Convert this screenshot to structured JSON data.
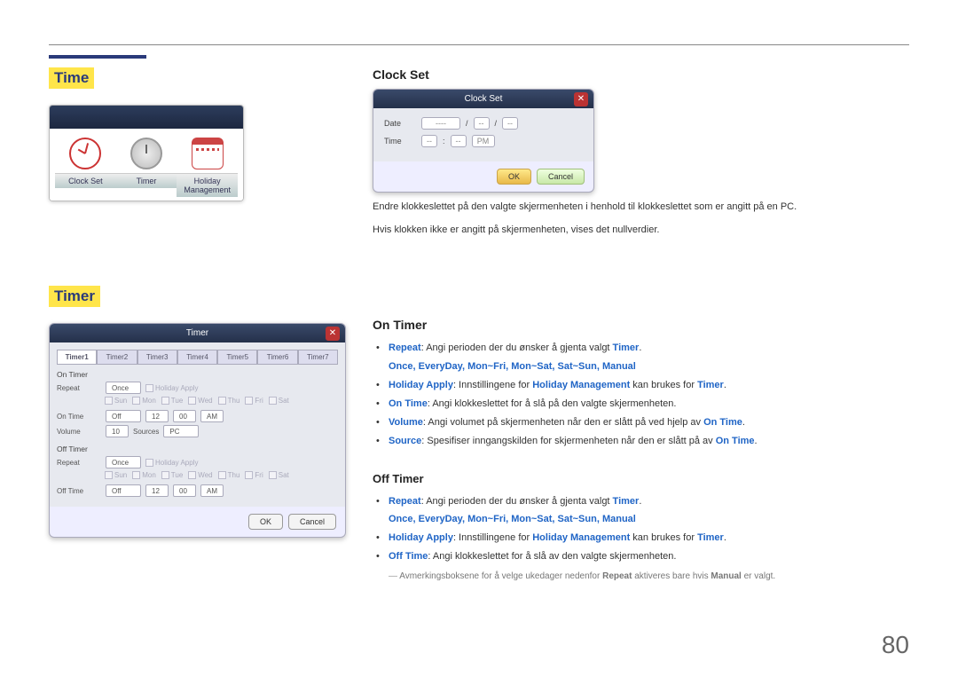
{
  "page_number": "80",
  "left": {
    "time_heading": "Time",
    "timer_heading": "Timer",
    "time_icons": {
      "clock_set": "Clock Set",
      "timer": "Timer",
      "holiday": "Holiday Management"
    },
    "timer_dialog": {
      "title": "Timer",
      "tabs": [
        "Timer1",
        "Timer2",
        "Timer3",
        "Timer4",
        "Timer5",
        "Timer6",
        "Timer7"
      ],
      "on_timer": "On Timer",
      "off_timer": "Off Timer",
      "repeat_label": "Repeat",
      "repeat_value": "Once",
      "holiday_apply": "Holiday Apply",
      "days": [
        "Sun",
        "Mon",
        "Tue",
        "Wed",
        "Thu",
        "Fri",
        "Sat"
      ],
      "on_time_label": "On Time",
      "on_time_on": "Off",
      "hour": "12",
      "min": "00",
      "ampm": "AM",
      "volume_label": "Volume",
      "volume_val": "10",
      "sources_label": "Sources",
      "sources_val": "PC",
      "off_time_label": "Off Time",
      "ok": "OK",
      "cancel": "Cancel"
    }
  },
  "right": {
    "clockset_heading": "Clock Set",
    "clockset_dialog": {
      "title": "Clock Set",
      "date": "Date",
      "time": "Time",
      "dash": "----",
      "dd": "--",
      "pm": "PM",
      "ok": "OK",
      "cancel": "Cancel"
    },
    "clockset_p1": "Endre klokkeslettet på den valgte skjermenheten i henhold til klokkeslettet som er angitt på en PC.",
    "clockset_p2": "Hvis klokken ikke er angitt på skjermenheten, vises det nullverdier.",
    "ontimer_heading": "On Timer",
    "offtimer_heading": "Off Timer",
    "bullets_on": {
      "repeat_pre": "Repeat",
      "repeat_txt": ": Angi perioden der du ønsker å gjenta valgt ",
      "timer_word": "Timer",
      "options": "Once, EveryDay, Mon~Fri, Mon~Sat, Sat~Sun, Manual",
      "holiday_pre": "Holiday Apply",
      "holiday_txt": ": Innstillingene for ",
      "holiday_k2": "Holiday Management",
      "holiday_end": " kan brukes for ",
      "on_time_pre": "On Time",
      "on_time_txt": ": Angi klokkeslettet for å slå på den valgte skjermenheten.",
      "volume_pre": "Volume",
      "volume_txt": ": Angi volumet på skjermenheten når den er slått på ved hjelp av ",
      "on_time_k": "On Time",
      "source_pre": "Source",
      "source_txt": ": Spesifiser inngangskilden for skjermenheten når den er slått på av "
    },
    "bullets_off": {
      "off_time_pre": "Off Time",
      "off_time_txt": ": Angi klokkeslettet for å slå av den valgte skjermenheten."
    },
    "note_txt_a": "Avmerkingsboksene for å velge ukedager nedenfor ",
    "note_txt_b": "Repeat",
    "note_txt_c": " aktiveres bare hvis ",
    "note_txt_d": "Manual",
    "note_txt_e": " er valgt."
  }
}
